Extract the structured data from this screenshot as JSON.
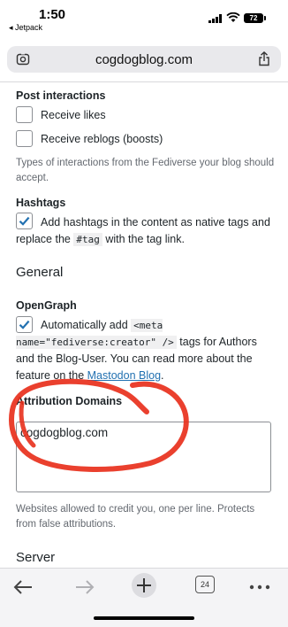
{
  "status_bar": {
    "time": "1:50",
    "back_app": "◂ Jetpack",
    "battery": "72"
  },
  "url_bar": {
    "url": "cogdogblog.com"
  },
  "post_interactions": {
    "heading": "Post interactions",
    "options": [
      {
        "label": "Receive likes",
        "checked": false
      },
      {
        "label": "Receive reblogs (boosts)",
        "checked": false
      }
    ],
    "description": "Types of interactions from the Fediverse your blog should accept."
  },
  "hashtags": {
    "heading": "Hashtags",
    "checked": true,
    "text_1": "Add hashtags in the content as native tags and replace the",
    "code": "#tag",
    "text_2": "with the tag link."
  },
  "general": {
    "heading": "General"
  },
  "opengraph": {
    "heading": "OpenGraph",
    "checked": true,
    "text_1": "Automatically add",
    "code": "<meta name=\"fediverse:creator\" />",
    "text_2": "tags for Authors and the Blog-User. You can read more about the feature on the",
    "link": "Mastodon Blog",
    "text_3": "."
  },
  "attribution": {
    "heading": "Attribution Domains",
    "value": "cogdogblog.com",
    "description": "Websites allowed to credit you, one per line. Protects from false attributions."
  },
  "server": {
    "heading": "Server"
  },
  "bottom_nav": {
    "tabs_count": "24"
  },
  "colors": {
    "accent": "#2271b1",
    "scribble": "#e8301c",
    "text": "#1d2327",
    "muted": "#646970"
  }
}
